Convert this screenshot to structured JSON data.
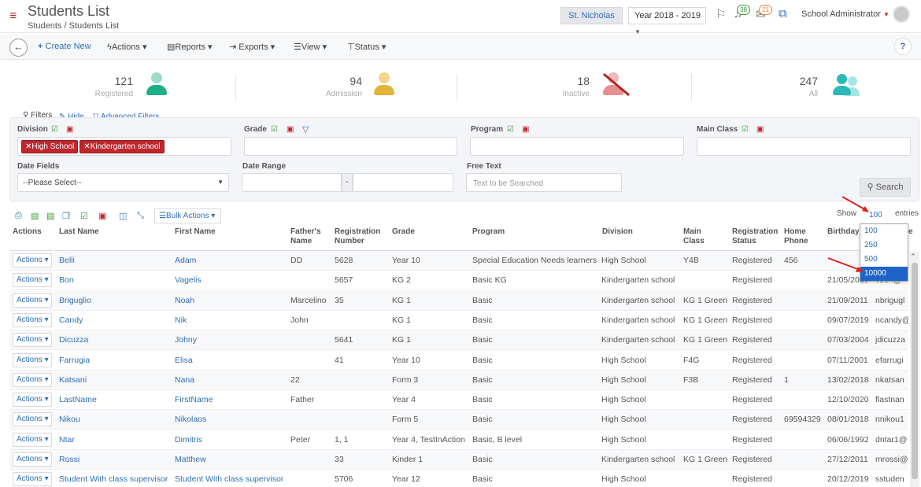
{
  "header": {
    "title": "Students List",
    "breadcrumb": [
      "Students",
      "Students List"
    ],
    "school": "St. Nicholas",
    "year": "Year 2018 - 2019",
    "badge_notifications": "38",
    "badge_messages": "21",
    "user": "School Administrator"
  },
  "toolbar": {
    "create": "Create New",
    "actions": "Actions",
    "reports": "Reports",
    "exports": "Exports",
    "view": "View",
    "status": "Status",
    "help": "?"
  },
  "stats": [
    {
      "count": "121",
      "label": "Registered",
      "color": "#1fae8a"
    },
    {
      "count": "94",
      "label": "Admission",
      "color": "#e4b33b"
    },
    {
      "count": "18",
      "label": "Inactive",
      "color": "#e58f8f"
    },
    {
      "count": "247",
      "label": "All",
      "color": "#2bb8b8"
    }
  ],
  "filters": {
    "title": "Filters",
    "hide": "Hide",
    "advanced": "Advanced Filters",
    "division_label": "Division",
    "division_chips": [
      "High School",
      "Kindergarten school"
    ],
    "grade_label": "Grade",
    "program_label": "Program",
    "mainclass_label": "Main Class",
    "date_fields_label": "Date Fields",
    "date_fields_value": "--Please Select--",
    "date_range_label": "Date Range",
    "date_sep": "-",
    "free_text_label": "Free Text",
    "free_text_placeholder": "Text to be Searched",
    "search": "Search"
  },
  "table": {
    "bulk_actions": "Bulk Actions",
    "show": "Show",
    "show_value": "100",
    "entries": "entries",
    "columns": [
      "Actions",
      "Last Name",
      "First Name",
      "Father's Name",
      "Registration Number",
      "Grade",
      "Program",
      "Division",
      "Main Class",
      "Registration Status",
      "Home Phone",
      "Birthday",
      "e"
    ],
    "action_label": "Actions",
    "rows": [
      {
        "last": "Belli",
        "first": "Adam",
        "father": "DD",
        "reg": "5628",
        "grade": "Year 10",
        "program": "Special Education Needs learners",
        "division": "High School",
        "mainclass": "Y4B",
        "status": "Registered",
        "phone": "456",
        "birthday": "",
        "email": ""
      },
      {
        "last": "Bon",
        "first": "Vagelis",
        "father": "",
        "reg": "5657",
        "grade": "KG 2",
        "program": "Basic KG",
        "division": "Kindergarten school",
        "mainclass": "",
        "status": "Registered",
        "phone": "",
        "birthday": "21/05/2019",
        "email": "vbon@"
      },
      {
        "last": "Briguglio",
        "first": "Noah",
        "father": "Marcelino",
        "reg": "35",
        "grade": "KG 1",
        "program": "Basic",
        "division": "Kindergarten school",
        "mainclass": "KG 1 Green",
        "status": "Registered",
        "phone": "",
        "birthday": "21/09/2011",
        "email": "nbrigugl"
      },
      {
        "last": "Candy",
        "first": "Nik",
        "father": "John",
        "reg": "",
        "grade": "KG 1",
        "program": "Basic",
        "division": "Kindergarten school",
        "mainclass": "KG 1 Green",
        "status": "Registered",
        "phone": "",
        "birthday": "09/07/2019",
        "email": "ncandy@"
      },
      {
        "last": "Dicuzza",
        "first": "Johny",
        "father": "",
        "reg": "5641",
        "grade": "KG 1",
        "program": "Basic",
        "division": "Kindergarten school",
        "mainclass": "KG 1 Green",
        "status": "Registered",
        "phone": "",
        "birthday": "07/03/2004",
        "email": "jdicuzza"
      },
      {
        "last": "Farrugia",
        "first": "Elisa",
        "father": "",
        "reg": "41",
        "grade": "Year 10",
        "program": "Basic",
        "division": "High School",
        "mainclass": "F4G",
        "status": "Registered",
        "phone": "",
        "birthday": "07/11/2001",
        "email": "efarrugi"
      },
      {
        "last": "Katsani",
        "first": "Nana",
        "father": "22",
        "reg": "",
        "grade": "Form 3",
        "program": "Basic",
        "division": "High School",
        "mainclass": "F3B",
        "status": "Registered",
        "phone": "1",
        "birthday": "13/02/2018",
        "email": "nkatsan"
      },
      {
        "last": "LastName",
        "first": "FirstName",
        "father": "Father",
        "reg": "",
        "grade": "Year 4",
        "program": "Basic",
        "division": "High School",
        "mainclass": "",
        "status": "Registered",
        "phone": "",
        "birthday": "12/10/2020",
        "email": "flastnan"
      },
      {
        "last": "Nikou",
        "first": "Nikolaos",
        "father": "",
        "reg": "",
        "grade": "Form 5",
        "program": "Basic",
        "division": "High School",
        "mainclass": "",
        "status": "Registered",
        "phone": "69594329",
        "birthday": "08/01/2018",
        "email": "nnikou1"
      },
      {
        "last": "Ntar",
        "first": "Dimitris",
        "father": "Peter",
        "reg": "1, 1",
        "grade": "Year 4, TestInAction",
        "program": "Basic, B level",
        "division": "High School",
        "mainclass": "",
        "status": "Registered",
        "phone": "",
        "birthday": "06/06/1992",
        "email": "dntar1@"
      },
      {
        "last": "Rossi",
        "first": "Matthew",
        "father": "",
        "reg": "33",
        "grade": "Kinder 1",
        "program": "Basic",
        "division": "Kindergarten school",
        "mainclass": "KG 1 Green",
        "status": "Registered",
        "phone": "",
        "birthday": "27/12/2011",
        "email": "mrossi@"
      },
      {
        "last": "Student With class supervisor",
        "first": "Student With class supervisor",
        "father": "",
        "reg": "5706",
        "grade": "Year 12",
        "program": "Basic",
        "division": "High School",
        "mainclass": "",
        "status": "Registered",
        "phone": "",
        "birthday": "20/12/2019",
        "email": "sstuden"
      }
    ],
    "page_size_options": [
      "100",
      "250",
      "500",
      "10000"
    ],
    "page_size_highlighted": "10000"
  }
}
